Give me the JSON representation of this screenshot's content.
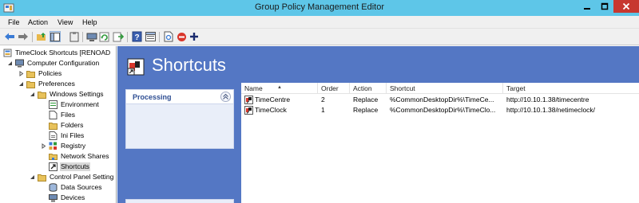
{
  "window": {
    "title": "Group Policy Management Editor",
    "controls": {
      "minimize": "minimize",
      "maximize": "maximize",
      "close": "close"
    }
  },
  "menu": [
    "File",
    "Action",
    "View",
    "Help"
  ],
  "toolbar_icons": [
    "back-arrow-icon",
    "forward-arrow-icon",
    "up-folder-icon",
    "show-hide-tree-icon",
    "clipboard-icon",
    "computer-icon",
    "refresh-icon",
    "export-icon",
    "help-icon",
    "properties-icon",
    "new-item-icon",
    "stop-icon",
    "add-icon"
  ],
  "tree": {
    "root": "TimeClock Shortcuts [RENOAD",
    "computer_configuration": "Computer Configuration",
    "policies": "Policies",
    "preferences": "Preferences",
    "windows_settings": "Windows Settings",
    "environment": "Environment",
    "files": "Files",
    "folders": "Folders",
    "ini_files": "Ini Files",
    "registry": "Registry",
    "network_shares": "Network Shares",
    "shortcuts": "Shortcuts",
    "control_panel_settings": "Control Panel Setting",
    "data_sources": "Data Sources",
    "devices": "Devices"
  },
  "main": {
    "header_title": "Shortcuts",
    "processing_panel": {
      "title": "Processing"
    },
    "columns": [
      "Name",
      "Order",
      "Action",
      "Shortcut",
      "Target"
    ],
    "rows": [
      {
        "name": "TimeCentre",
        "order": "2",
        "action": "Replace",
        "shortcut": "%CommonDesktopDir%\\TimeCe...",
        "target": "http://10.10.1.38/timecentre"
      },
      {
        "name": "TimeClock",
        "order": "1",
        "action": "Replace",
        "shortcut": "%CommonDesktopDir%\\TimeClo...",
        "target": "http://10.10.1.38/netimeclock/"
      }
    ]
  },
  "colors": {
    "titlebar": "#5ec6e8",
    "content_background": "#5477c4",
    "close_button": "#c7372f",
    "processing_title": "#2d4d92"
  }
}
